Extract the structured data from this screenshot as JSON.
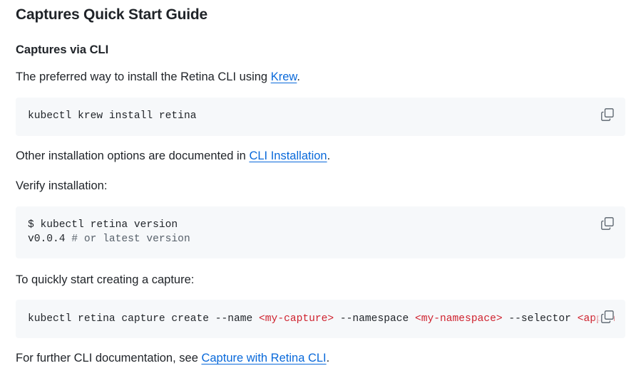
{
  "title": "Captures Quick Start Guide",
  "subtitle": "Captures via CLI",
  "para1": {
    "text": "The preferred way to install the Retina CLI using ",
    "link": "Krew",
    "end": "."
  },
  "code1": {
    "line": "kubectl krew install retina"
  },
  "para2": {
    "text": "Other installation options are documented in ",
    "link": "CLI Installation",
    "end": "."
  },
  "para3": {
    "text": "Verify installation:"
  },
  "code2": {
    "line1": "$ kubectl retina version",
    "line2_value": "v0.0.4",
    "line2_comment": " # or latest version"
  },
  "para4": {
    "text": "To quickly start creating a capture:"
  },
  "code3": {
    "seg1": "kubectl retina capture create --name ",
    "ph1": "<my-capture>",
    "seg2": " --namespace ",
    "ph2": "<my-namespace>",
    "seg3": " --selector ",
    "ph3": "<app=m"
  },
  "para5": {
    "text": "For further CLI documentation, see ",
    "link": "Capture with Retina CLI",
    "end": "."
  },
  "icons": {
    "copy": "copy-icon"
  },
  "colors": {
    "link": "#0969da",
    "code_bg": "#f6f8fa",
    "placeholder": "#cf222e",
    "comment": "#57606a"
  }
}
